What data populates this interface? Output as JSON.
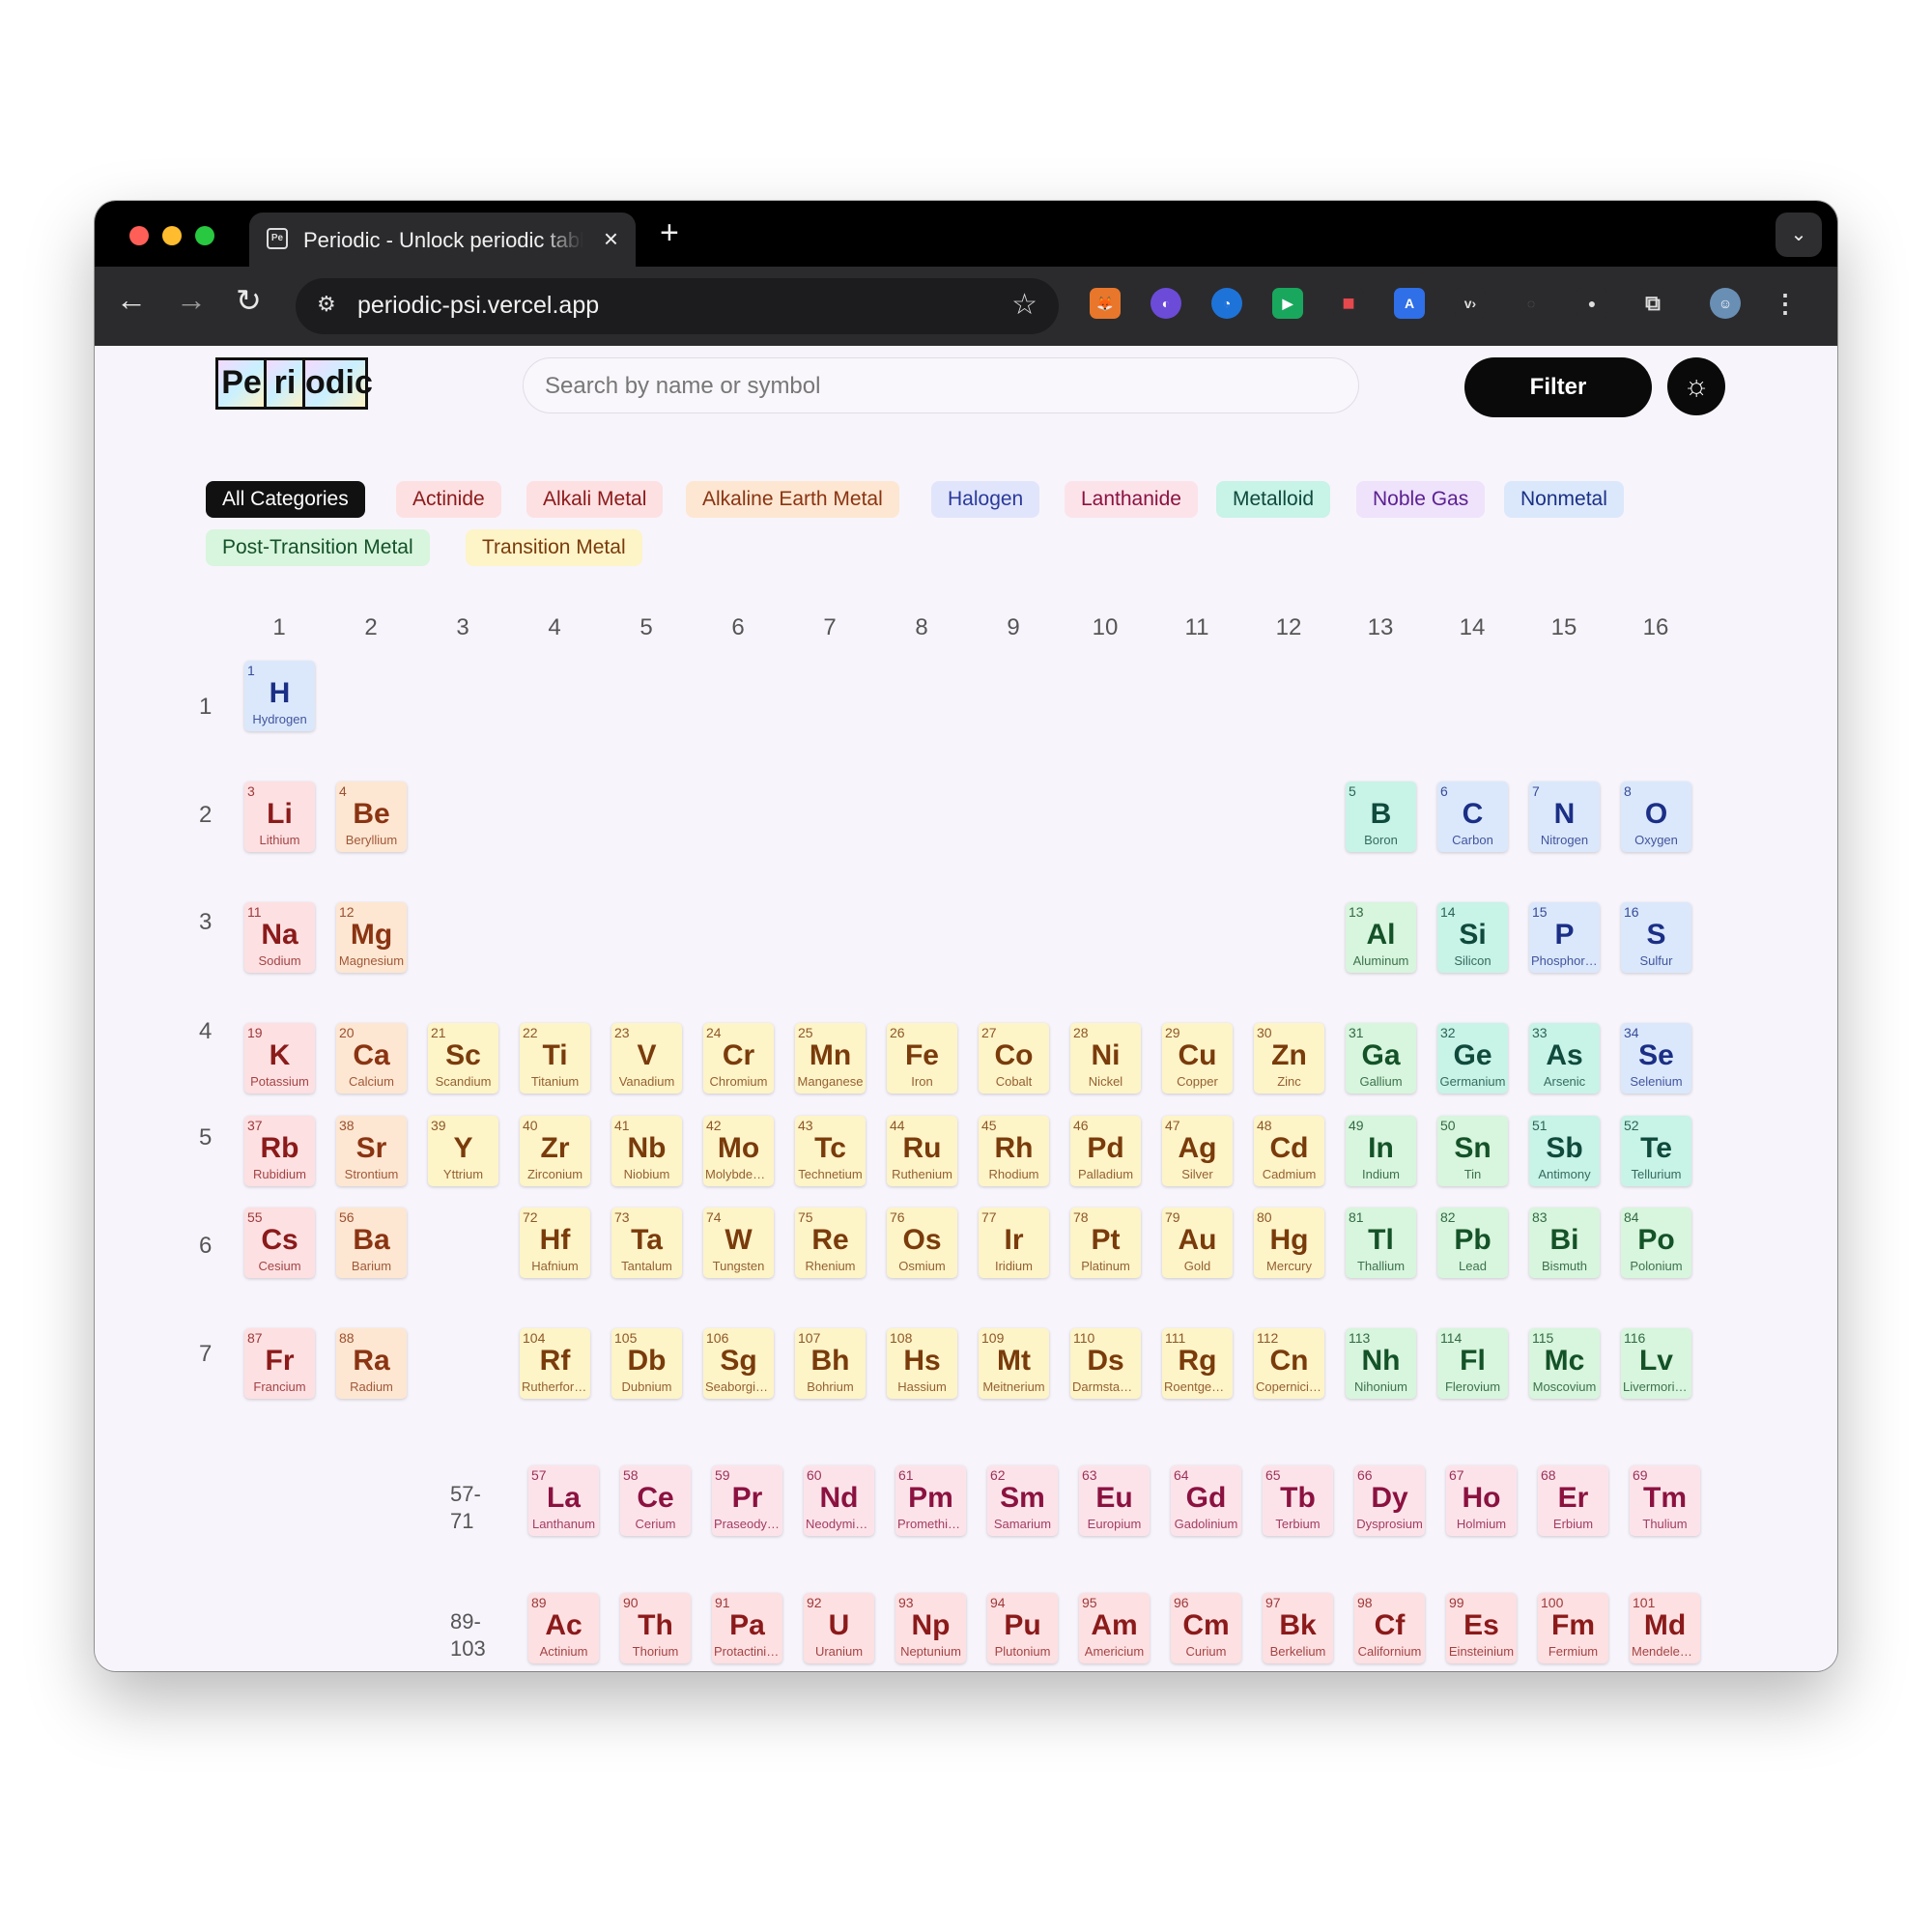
{
  "browser": {
    "tab_title": "Periodic - Unlock periodic table",
    "tab_favicon": "Pe",
    "url": "periodic-psi.vercel.app"
  },
  "header": {
    "logo_tiles": [
      "Pe",
      "ri",
      "odic"
    ],
    "search_placeholder": "Search by name or symbol",
    "filter_label": "Filter",
    "theme_icon": "sun-icon"
  },
  "categories": [
    {
      "label": "All Categories",
      "bg": "#111111",
      "fg": "#ffffff"
    },
    {
      "label": "Actinide",
      "bg": "#fde0e2",
      "fg": "#8b1a1a"
    },
    {
      "label": "Alkali Metal",
      "bg": "#fde0e2",
      "fg": "#8b1a1a"
    },
    {
      "label": "Alkaline Earth Metal",
      "bg": "#fde7d2",
      "fg": "#8a3412"
    },
    {
      "label": "Halogen",
      "bg": "#e1e5fb",
      "fg": "#2a3a9a"
    },
    {
      "label": "Lanthanide",
      "bg": "#fce3ea",
      "fg": "#8b1240"
    },
    {
      "label": "Metalloid",
      "bg": "#c8f3e7",
      "fg": "#0f4a3c"
    },
    {
      "label": "Noble Gas",
      "bg": "#efe2fb",
      "fg": "#5b2191"
    },
    {
      "label": "Nonmetal",
      "bg": "#dbe8fb",
      "fg": "#1b2f86"
    },
    {
      "label": "Post-Transition Metal",
      "bg": "#d8f5dd",
      "fg": "#145228"
    },
    {
      "label": "Transition Metal",
      "bg": "#fdf4c8",
      "fg": "#7a3b0b"
    }
  ],
  "group_numbers": [
    "1",
    "2",
    "3",
    "4",
    "5",
    "6",
    "7",
    "8",
    "9",
    "10",
    "11",
    "12",
    "13",
    "14",
    "15",
    "16"
  ],
  "period_numbers": [
    "1",
    "2",
    "3",
    "4",
    "5",
    "6",
    "7"
  ],
  "series_labels": {
    "lanthanides": "57-\n71",
    "actinides": "89-\n103"
  },
  "elements": [
    {
      "n": "1",
      "s": "H",
      "name": "Hydrogen",
      "g": 1,
      "p": 1,
      "c": "nonmetal"
    },
    {
      "n": "3",
      "s": "Li",
      "name": "Lithium",
      "g": 1,
      "p": 2,
      "c": "alkali"
    },
    {
      "n": "4",
      "s": "Be",
      "name": "Beryllium",
      "g": 2,
      "p": 2,
      "c": "alkaline"
    },
    {
      "n": "5",
      "s": "B",
      "name": "Boron",
      "g": 13,
      "p": 2,
      "c": "metalloid"
    },
    {
      "n": "6",
      "s": "C",
      "name": "Carbon",
      "g": 14,
      "p": 2,
      "c": "nonmetal"
    },
    {
      "n": "7",
      "s": "N",
      "name": "Nitrogen",
      "g": 15,
      "p": 2,
      "c": "nonmetal"
    },
    {
      "n": "8",
      "s": "O",
      "name": "Oxygen",
      "g": 16,
      "p": 2,
      "c": "nonmetal"
    },
    {
      "n": "11",
      "s": "Na",
      "name": "Sodium",
      "g": 1,
      "p": 3,
      "c": "alkali"
    },
    {
      "n": "12",
      "s": "Mg",
      "name": "Magnesium",
      "g": 2,
      "p": 3,
      "c": "alkaline"
    },
    {
      "n": "13",
      "s": "Al",
      "name": "Aluminum",
      "g": 13,
      "p": 3,
      "c": "post"
    },
    {
      "n": "14",
      "s": "Si",
      "name": "Silicon",
      "g": 14,
      "p": 3,
      "c": "metalloid"
    },
    {
      "n": "15",
      "s": "P",
      "name": "Phosphorus",
      "g": 15,
      "p": 3,
      "c": "nonmetal"
    },
    {
      "n": "16",
      "s": "S",
      "name": "Sulfur",
      "g": 16,
      "p": 3,
      "c": "nonmetal"
    },
    {
      "n": "19",
      "s": "K",
      "name": "Potassium",
      "g": 1,
      "p": 4,
      "c": "alkali"
    },
    {
      "n": "20",
      "s": "Ca",
      "name": "Calcium",
      "g": 2,
      "p": 4,
      "c": "alkaline"
    },
    {
      "n": "21",
      "s": "Sc",
      "name": "Scandium",
      "g": 3,
      "p": 4,
      "c": "transition"
    },
    {
      "n": "22",
      "s": "Ti",
      "name": "Titanium",
      "g": 4,
      "p": 4,
      "c": "transition"
    },
    {
      "n": "23",
      "s": "V",
      "name": "Vanadium",
      "g": 5,
      "p": 4,
      "c": "transition"
    },
    {
      "n": "24",
      "s": "Cr",
      "name": "Chromium",
      "g": 6,
      "p": 4,
      "c": "transition"
    },
    {
      "n": "25",
      "s": "Mn",
      "name": "Manganese",
      "g": 7,
      "p": 4,
      "c": "transition"
    },
    {
      "n": "26",
      "s": "Fe",
      "name": "Iron",
      "g": 8,
      "p": 4,
      "c": "transition"
    },
    {
      "n": "27",
      "s": "Co",
      "name": "Cobalt",
      "g": 9,
      "p": 4,
      "c": "transition"
    },
    {
      "n": "28",
      "s": "Ni",
      "name": "Nickel",
      "g": 10,
      "p": 4,
      "c": "transition"
    },
    {
      "n": "29",
      "s": "Cu",
      "name": "Copper",
      "g": 11,
      "p": 4,
      "c": "transition"
    },
    {
      "n": "30",
      "s": "Zn",
      "name": "Zinc",
      "g": 12,
      "p": 4,
      "c": "transition"
    },
    {
      "n": "31",
      "s": "Ga",
      "name": "Gallium",
      "g": 13,
      "p": 4,
      "c": "post"
    },
    {
      "n": "32",
      "s": "Ge",
      "name": "Germanium",
      "g": 14,
      "p": 4,
      "c": "metalloid"
    },
    {
      "n": "33",
      "s": "As",
      "name": "Arsenic",
      "g": 15,
      "p": 4,
      "c": "metalloid"
    },
    {
      "n": "34",
      "s": "Se",
      "name": "Selenium",
      "g": 16,
      "p": 4,
      "c": "nonmetal"
    },
    {
      "n": "37",
      "s": "Rb",
      "name": "Rubidium",
      "g": 1,
      "p": 5,
      "c": "alkali"
    },
    {
      "n": "38",
      "s": "Sr",
      "name": "Strontium",
      "g": 2,
      "p": 5,
      "c": "alkaline"
    },
    {
      "n": "39",
      "s": "Y",
      "name": "Yttrium",
      "g": 3,
      "p": 5,
      "c": "transition"
    },
    {
      "n": "40",
      "s": "Zr",
      "name": "Zirconium",
      "g": 4,
      "p": 5,
      "c": "transition"
    },
    {
      "n": "41",
      "s": "Nb",
      "name": "Niobium",
      "g": 5,
      "p": 5,
      "c": "transition"
    },
    {
      "n": "42",
      "s": "Mo",
      "name": "Molybdenum",
      "g": 6,
      "p": 5,
      "c": "transition"
    },
    {
      "n": "43",
      "s": "Tc",
      "name": "Technetium",
      "g": 7,
      "p": 5,
      "c": "transition"
    },
    {
      "n": "44",
      "s": "Ru",
      "name": "Ruthenium",
      "g": 8,
      "p": 5,
      "c": "transition"
    },
    {
      "n": "45",
      "s": "Rh",
      "name": "Rhodium",
      "g": 9,
      "p": 5,
      "c": "transition"
    },
    {
      "n": "46",
      "s": "Pd",
      "name": "Palladium",
      "g": 10,
      "p": 5,
      "c": "transition"
    },
    {
      "n": "47",
      "s": "Ag",
      "name": "Silver",
      "g": 11,
      "p": 5,
      "c": "transition"
    },
    {
      "n": "48",
      "s": "Cd",
      "name": "Cadmium",
      "g": 12,
      "p": 5,
      "c": "transition"
    },
    {
      "n": "49",
      "s": "In",
      "name": "Indium",
      "g": 13,
      "p": 5,
      "c": "post"
    },
    {
      "n": "50",
      "s": "Sn",
      "name": "Tin",
      "g": 14,
      "p": 5,
      "c": "post"
    },
    {
      "n": "51",
      "s": "Sb",
      "name": "Antimony",
      "g": 15,
      "p": 5,
      "c": "metalloid"
    },
    {
      "n": "52",
      "s": "Te",
      "name": "Tellurium",
      "g": 16,
      "p": 5,
      "c": "metalloid"
    },
    {
      "n": "55",
      "s": "Cs",
      "name": "Cesium",
      "g": 1,
      "p": 6,
      "c": "alkali"
    },
    {
      "n": "56",
      "s": "Ba",
      "name": "Barium",
      "g": 2,
      "p": 6,
      "c": "alkaline"
    },
    {
      "n": "72",
      "s": "Hf",
      "name": "Hafnium",
      "g": 4,
      "p": 6,
      "c": "transition"
    },
    {
      "n": "73",
      "s": "Ta",
      "name": "Tantalum",
      "g": 5,
      "p": 6,
      "c": "transition"
    },
    {
      "n": "74",
      "s": "W",
      "name": "Tungsten",
      "g": 6,
      "p": 6,
      "c": "transition"
    },
    {
      "n": "75",
      "s": "Re",
      "name": "Rhenium",
      "g": 7,
      "p": 6,
      "c": "transition"
    },
    {
      "n": "76",
      "s": "Os",
      "name": "Osmium",
      "g": 8,
      "p": 6,
      "c": "transition"
    },
    {
      "n": "77",
      "s": "Ir",
      "name": "Iridium",
      "g": 9,
      "p": 6,
      "c": "transition"
    },
    {
      "n": "78",
      "s": "Pt",
      "name": "Platinum",
      "g": 10,
      "p": 6,
      "c": "transition"
    },
    {
      "n": "79",
      "s": "Au",
      "name": "Gold",
      "g": 11,
      "p": 6,
      "c": "transition"
    },
    {
      "n": "80",
      "s": "Hg",
      "name": "Mercury",
      "g": 12,
      "p": 6,
      "c": "transition"
    },
    {
      "n": "81",
      "s": "Tl",
      "name": "Thallium",
      "g": 13,
      "p": 6,
      "c": "post"
    },
    {
      "n": "82",
      "s": "Pb",
      "name": "Lead",
      "g": 14,
      "p": 6,
      "c": "post"
    },
    {
      "n": "83",
      "s": "Bi",
      "name": "Bismuth",
      "g": 15,
      "p": 6,
      "c": "post"
    },
    {
      "n": "84",
      "s": "Po",
      "name": "Polonium",
      "g": 16,
      "p": 6,
      "c": "post"
    },
    {
      "n": "87",
      "s": "Fr",
      "name": "Francium",
      "g": 1,
      "p": 7,
      "c": "alkali"
    },
    {
      "n": "88",
      "s": "Ra",
      "name": "Radium",
      "g": 2,
      "p": 7,
      "c": "alkaline"
    },
    {
      "n": "104",
      "s": "Rf",
      "name": "Rutherfordium",
      "g": 4,
      "p": 7,
      "c": "transition"
    },
    {
      "n": "105",
      "s": "Db",
      "name": "Dubnium",
      "g": 5,
      "p": 7,
      "c": "transition"
    },
    {
      "n": "106",
      "s": "Sg",
      "name": "Seaborgium",
      "g": 6,
      "p": 7,
      "c": "transition"
    },
    {
      "n": "107",
      "s": "Bh",
      "name": "Bohrium",
      "g": 7,
      "p": 7,
      "c": "transition"
    },
    {
      "n": "108",
      "s": "Hs",
      "name": "Hassium",
      "g": 8,
      "p": 7,
      "c": "transition"
    },
    {
      "n": "109",
      "s": "Mt",
      "name": "Meitnerium",
      "g": 9,
      "p": 7,
      "c": "transition"
    },
    {
      "n": "110",
      "s": "Ds",
      "name": "Darmstadtium",
      "g": 10,
      "p": 7,
      "c": "transition"
    },
    {
      "n": "111",
      "s": "Rg",
      "name": "Roentgenium",
      "g": 11,
      "p": 7,
      "c": "transition"
    },
    {
      "n": "112",
      "s": "Cn",
      "name": "Copernicium",
      "g": 12,
      "p": 7,
      "c": "transition"
    },
    {
      "n": "113",
      "s": "Nh",
      "name": "Nihonium",
      "g": 13,
      "p": 7,
      "c": "post"
    },
    {
      "n": "114",
      "s": "Fl",
      "name": "Flerovium",
      "g": 14,
      "p": 7,
      "c": "post"
    },
    {
      "n": "115",
      "s": "Mc",
      "name": "Moscovium",
      "g": 15,
      "p": 7,
      "c": "post"
    },
    {
      "n": "116",
      "s": "Lv",
      "name": "Livermorium",
      "g": 16,
      "p": 7,
      "c": "post"
    }
  ],
  "lanthanides": [
    {
      "n": "57",
      "s": "La",
      "name": "Lanthanum"
    },
    {
      "n": "58",
      "s": "Ce",
      "name": "Cerium"
    },
    {
      "n": "59",
      "s": "Pr",
      "name": "Praseodymium"
    },
    {
      "n": "60",
      "s": "Nd",
      "name": "Neodymium"
    },
    {
      "n": "61",
      "s": "Pm",
      "name": "Promethium"
    },
    {
      "n": "62",
      "s": "Sm",
      "name": "Samarium"
    },
    {
      "n": "63",
      "s": "Eu",
      "name": "Europium"
    },
    {
      "n": "64",
      "s": "Gd",
      "name": "Gadolinium"
    },
    {
      "n": "65",
      "s": "Tb",
      "name": "Terbium"
    },
    {
      "n": "66",
      "s": "Dy",
      "name": "Dysprosium"
    },
    {
      "n": "67",
      "s": "Ho",
      "name": "Holmium"
    },
    {
      "n": "68",
      "s": "Er",
      "name": "Erbium"
    },
    {
      "n": "69",
      "s": "Tm",
      "name": "Thulium"
    }
  ],
  "actinides": [
    {
      "n": "89",
      "s": "Ac",
      "name": "Actinium"
    },
    {
      "n": "90",
      "s": "Th",
      "name": "Thorium"
    },
    {
      "n": "91",
      "s": "Pa",
      "name": "Protactinium"
    },
    {
      "n": "92",
      "s": "U",
      "name": "Uranium"
    },
    {
      "n": "93",
      "s": "Np",
      "name": "Neptunium"
    },
    {
      "n": "94",
      "s": "Pu",
      "name": "Plutonium"
    },
    {
      "n": "95",
      "s": "Am",
      "name": "Americium"
    },
    {
      "n": "96",
      "s": "Cm",
      "name": "Curium"
    },
    {
      "n": "97",
      "s": "Bk",
      "name": "Berkelium"
    },
    {
      "n": "98",
      "s": "Cf",
      "name": "Californium"
    },
    {
      "n": "99",
      "s": "Es",
      "name": "Einsteinium"
    },
    {
      "n": "100",
      "s": "Fm",
      "name": "Fermium"
    },
    {
      "n": "101",
      "s": "Md",
      "name": "Mendelevium"
    }
  ]
}
